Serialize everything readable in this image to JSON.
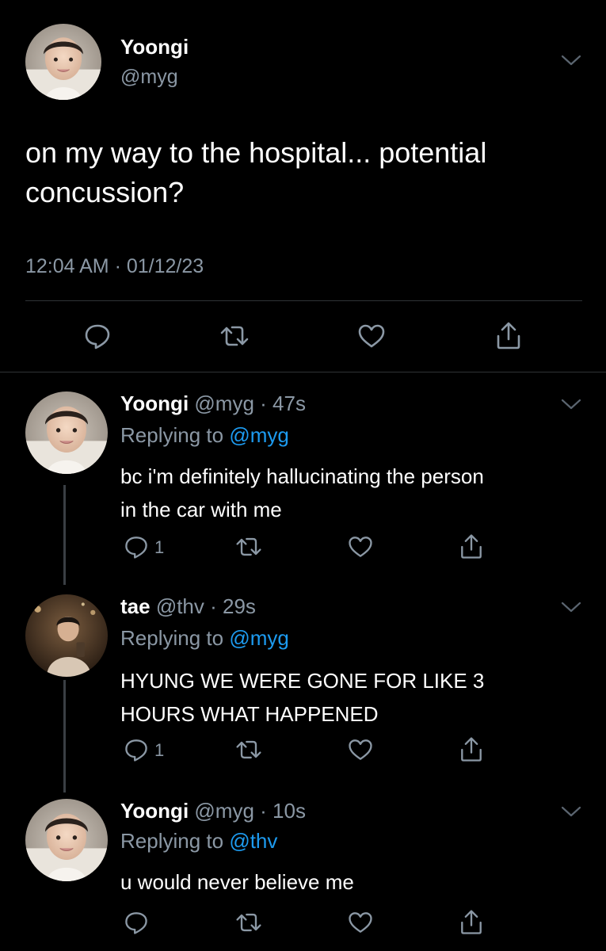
{
  "main_tweet": {
    "name": "Yoongi",
    "handle": "@myg",
    "text_line1": "on my way to the hospital... potential",
    "text_line2": "concussion?",
    "timestamp": "12:04 AM · 01/12/23"
  },
  "replies": [
    {
      "name": "Yoongi",
      "meta": "@myg · 47s",
      "replying_prefix": "Replying to ",
      "replying_to": "@myg",
      "text_line1": "bc i'm definitely hallucinating the person",
      "text_line2": "in the car with me",
      "reply_count": "1"
    },
    {
      "name": "tae",
      "meta": "@thv · 29s",
      "replying_prefix": "Replying to ",
      "replying_to": "@myg",
      "text_line1": "HYUNG WE WERE GONE FOR LIKE 3",
      "text_line2": "HOURS WHAT HAPPENED",
      "reply_count": "1"
    },
    {
      "name": "Yoongi",
      "meta": "@myg · 10s",
      "replying_prefix": "Replying to ",
      "replying_to": "@thv",
      "text_line1": "u would never believe me",
      "text_line2": "",
      "reply_count": ""
    }
  ],
  "icons": {
    "reply": "reply-icon",
    "retweet": "retweet-icon",
    "like": "like-icon",
    "share": "share-icon",
    "more": "chevron-down-icon"
  },
  "colors": {
    "background": "#000000",
    "text": "#ffffff",
    "secondary": "#8b98a5",
    "accent": "#1d9bf0"
  }
}
